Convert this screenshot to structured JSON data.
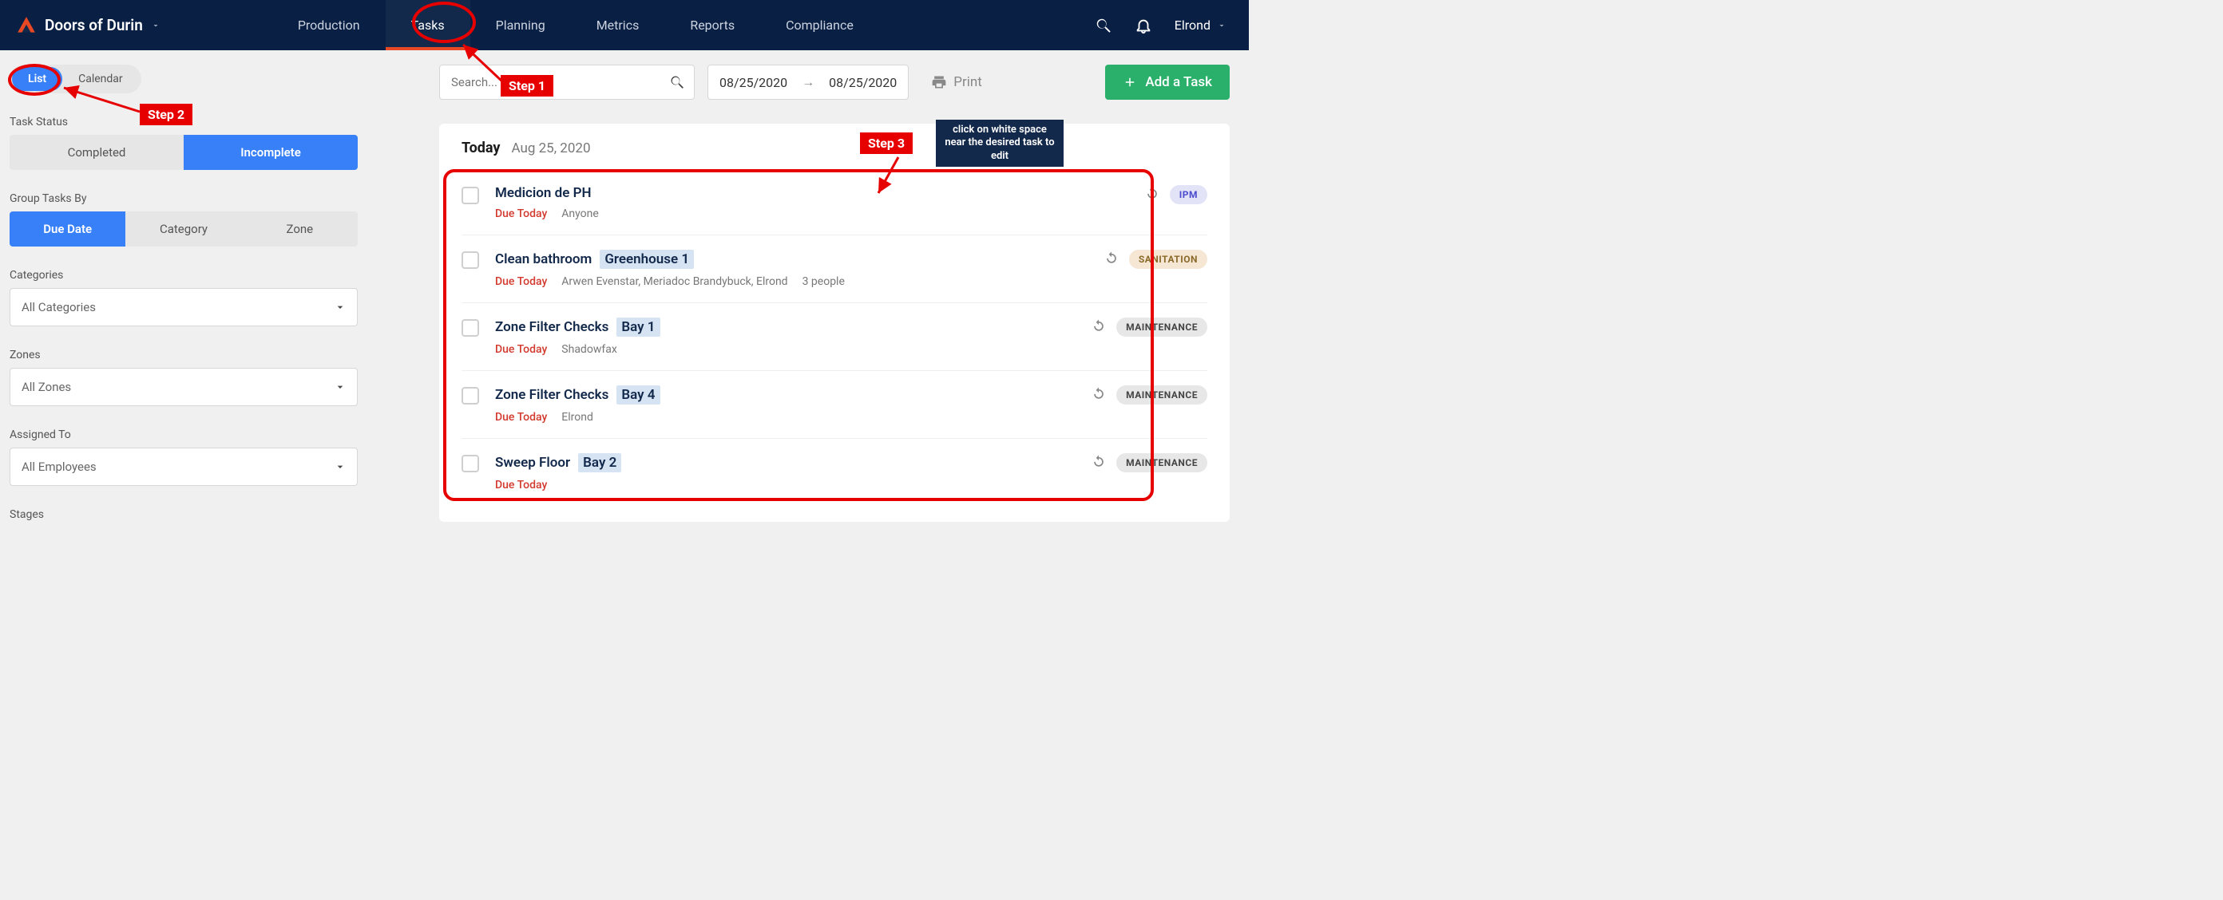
{
  "header": {
    "brand": "Doors of Durin",
    "nav": [
      "Production",
      "Tasks",
      "Planning",
      "Metrics",
      "Reports",
      "Compliance"
    ],
    "active_nav": 1,
    "user": "Elrond"
  },
  "sidebar": {
    "view_tabs": [
      "List",
      "Calendar"
    ],
    "active_view": 0,
    "status_label": "Task Status",
    "status_tabs": [
      "Completed",
      "Incomplete"
    ],
    "active_status": 1,
    "group_label": "Group Tasks By",
    "group_tabs": [
      "Due Date",
      "Category",
      "Zone"
    ],
    "active_group": 0,
    "categories_label": "Categories",
    "categories_value": "All Categories",
    "zones_label": "Zones",
    "zones_value": "All Zones",
    "assigned_label": "Assigned To",
    "assigned_value": "All Employees",
    "stages_label": "Stages"
  },
  "main": {
    "search_placeholder": "Search...",
    "date_from": "08/25/2020",
    "date_to": "08/25/2020",
    "print_label": "Print",
    "add_label": "Add a Task",
    "today_label": "Today",
    "today_date": "Aug 25, 2020",
    "tasks": [
      {
        "title": "Medicion de PH",
        "zone": "",
        "due": "Due Today",
        "assignees": "Anyone",
        "count": "",
        "cat": "IPM",
        "catClass": "ipm"
      },
      {
        "title": "Clean bathroom",
        "zone": "Greenhouse 1",
        "due": "Due Today",
        "assignees": "Arwen Evenstar, Meriadoc Brandybuck, Elrond",
        "count": "3 people",
        "cat": "SANITATION",
        "catClass": "san"
      },
      {
        "title": "Zone Filter Checks",
        "zone": "Bay 1",
        "due": "Due Today",
        "assignees": "Shadowfax",
        "count": "",
        "cat": "MAINTENANCE",
        "catClass": "maint"
      },
      {
        "title": "Zone Filter Checks",
        "zone": "Bay 4",
        "due": "Due Today",
        "assignees": "Elrond",
        "count": "",
        "cat": "MAINTENANCE",
        "catClass": "maint"
      },
      {
        "title": "Sweep Floor",
        "zone": "Bay 2",
        "due": "Due Today",
        "assignees": "",
        "count": "",
        "cat": "MAINTENANCE",
        "catClass": "maint"
      }
    ]
  },
  "annotations": {
    "step1": "Step 1",
    "step2": "Step 2",
    "step3": "Step 3",
    "tooltip": "click on white space near the desired task to edit"
  }
}
